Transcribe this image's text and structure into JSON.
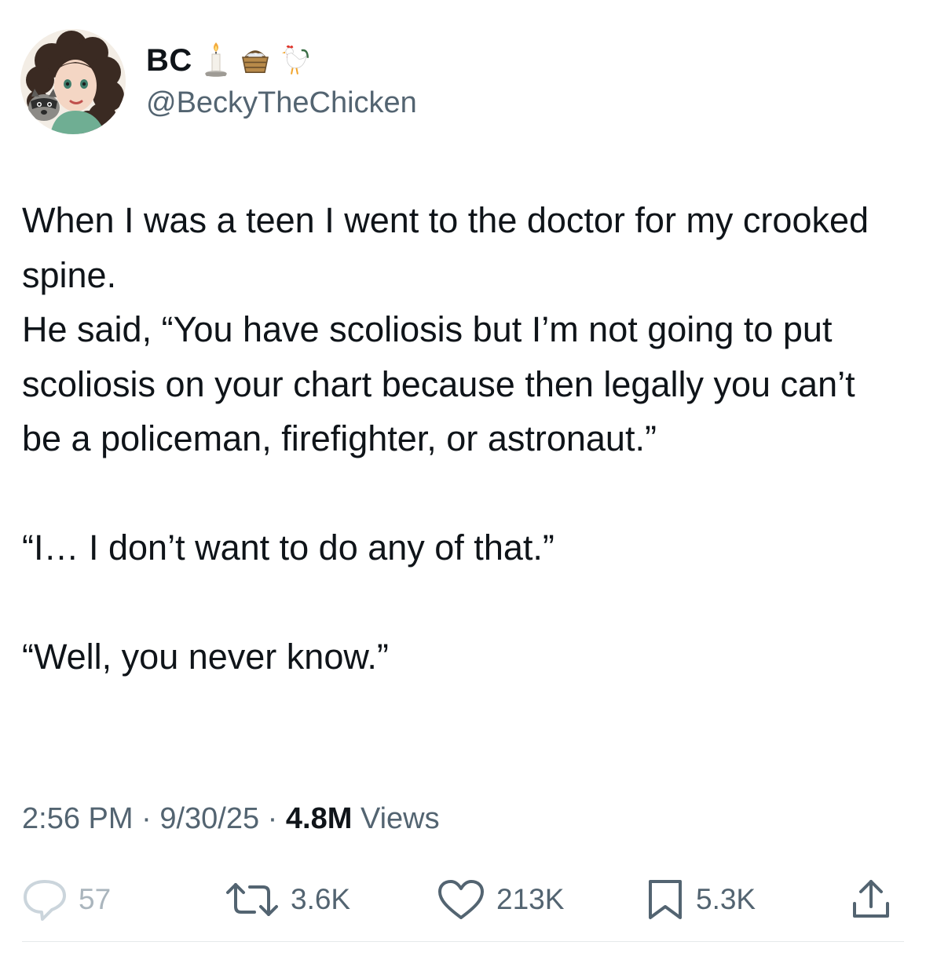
{
  "author": {
    "display_name": "BC",
    "handle": "@BeckyTheChicken",
    "name_emojis": [
      "candle-icon",
      "basket-icon",
      "rooster-icon"
    ]
  },
  "tweet": {
    "paragraph1": "When I was a teen I went to the doctor for my crooked spine.",
    "paragraph2": "He said, “You have scoliosis but I’m not going to put scoliosis on your chart because then legally you can’t be a policeman, firefighter, or astronaut.”",
    "paragraph3": "“I… I don’t want to do any of that.”",
    "paragraph4": "“Well, you never know.”"
  },
  "meta": {
    "time": "2:56 PM",
    "date": "9/30/25",
    "views_count": "4.8M",
    "views_label": "Views",
    "separator": "·"
  },
  "actions": {
    "replies": "57",
    "reposts": "3.6K",
    "likes": "213K",
    "bookmarks": "5.3K"
  },
  "colors": {
    "text": "#0f1419",
    "secondary": "#536471",
    "background": "#ffffff"
  }
}
